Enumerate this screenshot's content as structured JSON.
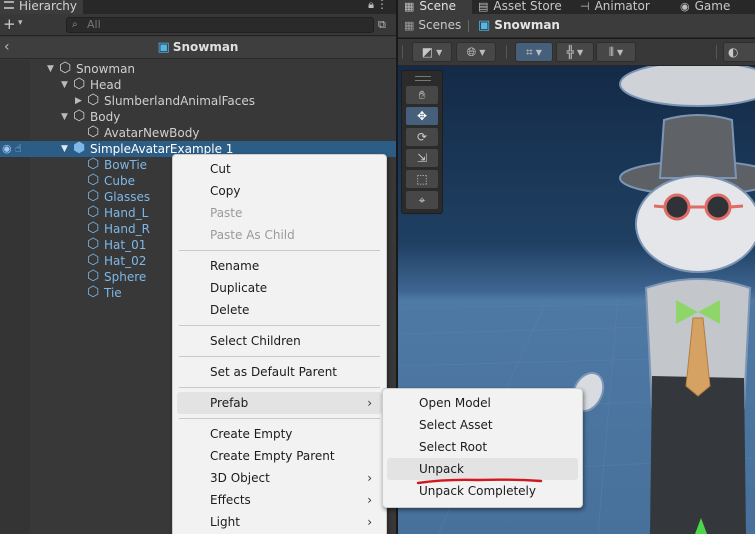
{
  "hierarchy": {
    "tab_title": "Hierarchy",
    "search_placeholder": "All",
    "header_title": "Snowman",
    "items": [
      {
        "label": "Snowman"
      },
      {
        "label": "Head"
      },
      {
        "label": "SlumberlandAnimalFaces"
      },
      {
        "label": "Body"
      },
      {
        "label": "AvatarNewBody"
      },
      {
        "label": "SimpleAvatarExample 1"
      },
      {
        "label": "BowTie"
      },
      {
        "label": "Cube"
      },
      {
        "label": "Glasses"
      },
      {
        "label": "Hand_L"
      },
      {
        "label": "Hand_R"
      },
      {
        "label": "Hat_01"
      },
      {
        "label": "Hat_02"
      },
      {
        "label": "Sphere"
      },
      {
        "label": "Tie"
      }
    ]
  },
  "scene": {
    "tabs": [
      {
        "label": "Scene"
      },
      {
        "label": "Asset Store"
      },
      {
        "label": "Animator"
      },
      {
        "label": "Game"
      }
    ],
    "breadcrumb_root": "Scenes",
    "breadcrumb_current": "Snowman"
  },
  "context_menu": {
    "items": [
      {
        "label": "Cut"
      },
      {
        "label": "Copy"
      },
      {
        "label": "Paste"
      },
      {
        "label": "Paste As Child"
      },
      {
        "label": "Rename"
      },
      {
        "label": "Duplicate"
      },
      {
        "label": "Delete"
      },
      {
        "label": "Select Children"
      },
      {
        "label": "Set as Default Parent"
      },
      {
        "label": "Prefab"
      },
      {
        "label": "Create Empty"
      },
      {
        "label": "Create Empty Parent"
      },
      {
        "label": "3D Object"
      },
      {
        "label": "Effects"
      },
      {
        "label": "Light"
      }
    ]
  },
  "prefab_submenu": {
    "items": [
      {
        "label": "Open Model"
      },
      {
        "label": "Select Asset"
      },
      {
        "label": "Select Root"
      },
      {
        "label": "Unpack"
      },
      {
        "label": "Unpack Completely"
      }
    ]
  },
  "colors": {
    "selection": "#2c5d87",
    "prefab_blue": "#7db8e8",
    "annotation_red": "#d4171c",
    "menu_bg": "#f2f2f2"
  }
}
